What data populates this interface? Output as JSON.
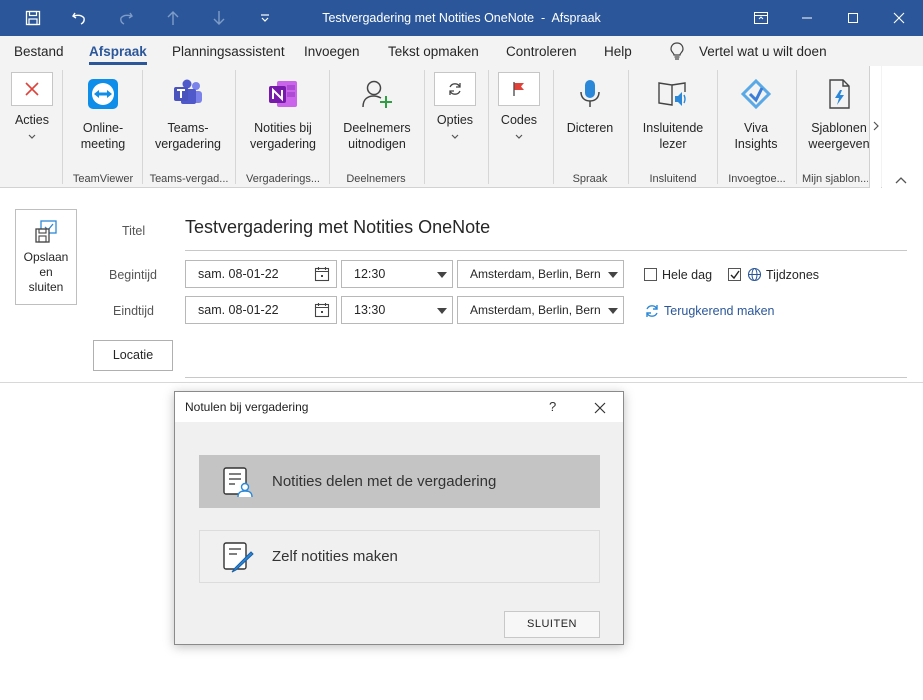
{
  "window": {
    "title": "Testvergadering met Notities OneNote  -  Afspraak"
  },
  "menu": {
    "tabs": [
      "Bestand",
      "Afspraak",
      "Planningsassistent",
      "Invoegen",
      "Tekst opmaken",
      "Controleren",
      "Help"
    ],
    "active_tab": "Afspraak",
    "tell_me": "Vertel wat u wilt doen"
  },
  "ribbon": {
    "buttons": [
      {
        "label": "Acties",
        "icon": "close-x-icon"
      },
      {
        "label": "Online-\nmeeting",
        "icon": "teamviewer-icon"
      },
      {
        "label": "Teams-\nvergadering",
        "icon": "teams-icon"
      },
      {
        "label": "Notities bij\nvergadering",
        "icon": "onenote-icon"
      },
      {
        "label": "Deelnemers\nuitnodigen",
        "icon": "add-person-icon"
      },
      {
        "label": "Opties",
        "icon": "refresh-icon"
      },
      {
        "label": "Codes",
        "icon": "flag-icon"
      },
      {
        "label": "Dicteren",
        "icon": "microphone-icon"
      },
      {
        "label": "Insluitende\nlezer",
        "icon": "reader-icon"
      },
      {
        "label": "Viva\nInsights",
        "icon": "viva-icon"
      },
      {
        "label": "Sjablonen\nweergeven",
        "icon": "template-icon"
      }
    ],
    "groups": [
      "TeamViewer",
      "Teams-vergad...",
      "Vergaderings...",
      "Deelnemers",
      "Spraak",
      "Insluitend",
      "Invoegtoe...",
      "Mijn sjablon..."
    ]
  },
  "form": {
    "save_button": "Opslaan\nen\nsluiten",
    "title_label": "Titel",
    "title_value": "Testvergadering met Notities OneNote",
    "start_label": "Begintijd",
    "end_label": "Eindtijd",
    "start_date": "sam. 08-01-22",
    "start_time": "12:30",
    "end_date": "sam. 08-01-22",
    "end_time": "13:30",
    "timezone": "Amsterdam, Berlin, Bern",
    "all_day": "Hele dag",
    "timezones": "Tijdzones",
    "recurring": "Terugkerend maken",
    "location_button": "Locatie",
    "all_day_checked": false,
    "timezones_checked": true
  },
  "dialog": {
    "title": "Notulen bij vergadering",
    "help": "?",
    "option1": "Notities delen met de vergadering",
    "option2": "Zelf notities maken",
    "close_button": "SLUITEN"
  }
}
